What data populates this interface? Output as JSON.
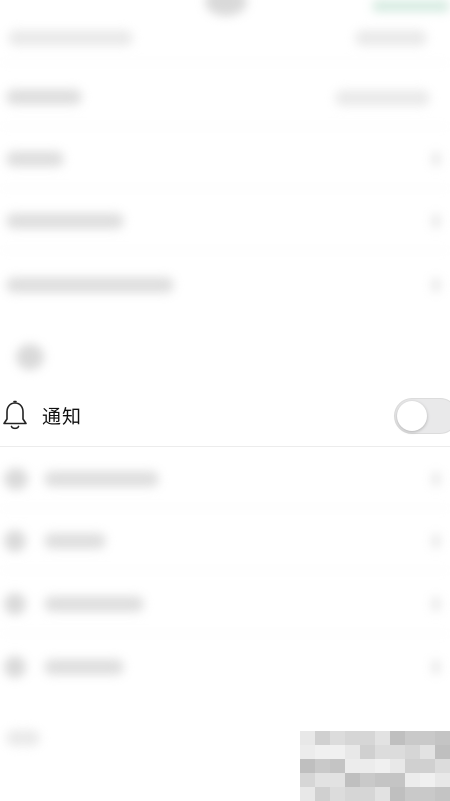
{
  "notification_row": {
    "label": "通知",
    "toggle_on": false
  },
  "icons": {
    "bell": "bell-icon"
  },
  "colors": {
    "toggle_off": "#e9e9ea",
    "background": "#ffffff",
    "text": "#111111"
  }
}
